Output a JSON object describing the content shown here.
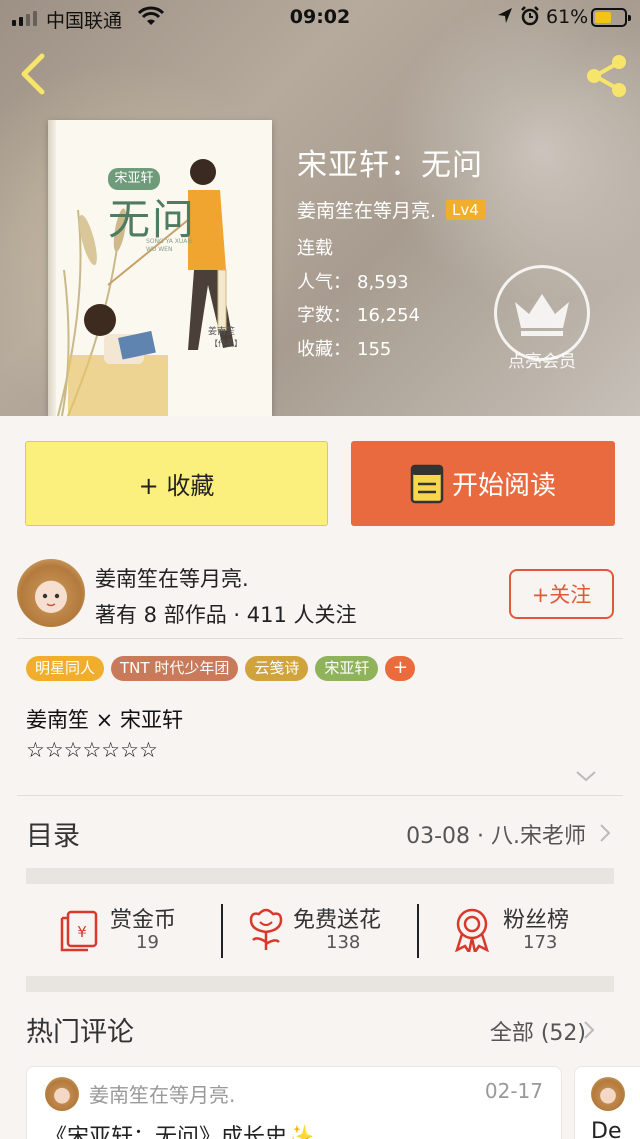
{
  "status_bar": {
    "carrier": "中国联通",
    "time": "09:02",
    "battery": "61%"
  },
  "cover": {
    "title_art": "无问",
    "seal_text": "宋亚轩",
    "subtitle_art": "SONG YA XUAN WU WEN",
    "author_art": "姜南笙",
    "works_art": "【作品】"
  },
  "book": {
    "title": "宋亚轩：无问",
    "author": "姜南笙在等月亮.",
    "level": "Lv4",
    "status": "连载",
    "popularity_label": "人气：",
    "popularity": "8,593",
    "words_label": "字数：",
    "words": "16,254",
    "favorites_label": "收藏：",
    "favorites": "155"
  },
  "vip": {
    "label": "点亮会员"
  },
  "actions": {
    "collect": "+ 收藏",
    "read": "开始阅读"
  },
  "author_card": {
    "name": "姜南笙在等月亮.",
    "stats": "著有 8 部作品 · 411 人关注",
    "follow": "+关注"
  },
  "tags": [
    {
      "label": "明星同人",
      "color": "#f0ae2c"
    },
    {
      "label": "TNT 时代少年团",
      "color": "#c97a5b"
    },
    {
      "label": "云笺诗",
      "color": "#d0a33c"
    },
    {
      "label": "宋亚轩",
      "color": "#8fb35a"
    }
  ],
  "tag_more": "+",
  "description": {
    "line1": "姜南笙 × 宋亚轩",
    "line2": "☆☆☆☆☆☆☆"
  },
  "toc": {
    "label": "目录",
    "latest": "03-08 · 八.宋老师"
  },
  "rewards": [
    {
      "title": "赏金币",
      "count": "19",
      "icon": "red-envelope-icon"
    },
    {
      "title": "免费送花",
      "count": "138",
      "icon": "flower-icon"
    },
    {
      "title": "粉丝榜",
      "count": "173",
      "icon": "ribbon-badge-icon"
    }
  ],
  "comments": {
    "title": "热门评论",
    "all": "全部 (52)",
    "items": [
      {
        "user": "姜南笙在等月亮.",
        "date": "02-17",
        "text": "《宋亚轩：无问》成长史✨"
      },
      {
        "text": "De"
      }
    ]
  },
  "colors": {
    "accent": "#e96a3e",
    "collect_bg": "#fbf07d",
    "lv_badge": "#f0ae2c"
  }
}
